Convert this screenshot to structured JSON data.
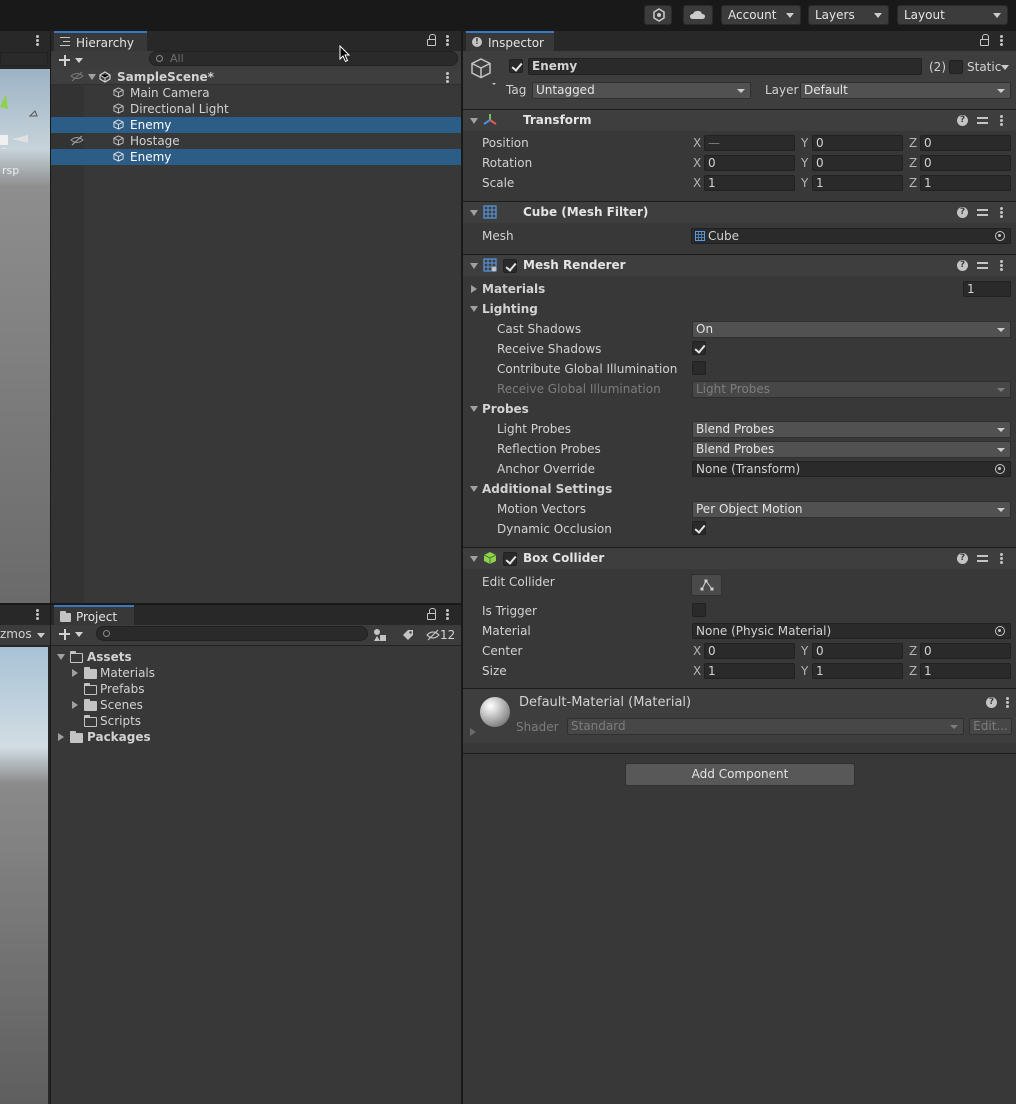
{
  "toolbar": {
    "account_label": "Account",
    "layers_label": "Layers",
    "layout_label": "Layout",
    "collab_icon": "collab-icon",
    "cloud_icon": "cloud-icon"
  },
  "scene_view": {
    "label_fragment": "rsp",
    "gizmos_fragment": "zmos"
  },
  "hierarchy": {
    "tab_label": "Hierarchy",
    "search_placeholder": "All",
    "items": [
      {
        "label": "SampleScene*"
      },
      {
        "label": "Main Camera"
      },
      {
        "label": "Directional Light"
      },
      {
        "label": "Enemy"
      },
      {
        "label": "Hostage"
      },
      {
        "label": "Enemy"
      }
    ]
  },
  "project": {
    "tab_label": "Project",
    "hidden_count": "12",
    "tree": [
      {
        "label": "Assets"
      },
      {
        "label": "Materials"
      },
      {
        "label": "Prefabs"
      },
      {
        "label": "Scenes"
      },
      {
        "label": "Scripts"
      },
      {
        "label": "Packages"
      }
    ]
  },
  "inspector": {
    "tab_label": "Inspector",
    "object_name": "Enemy",
    "multi_count": "(2)",
    "static_label": "Static",
    "tag_label": "Tag",
    "tag_value": "Untagged",
    "layer_label": "Layer",
    "layer_value": "Default",
    "transform": {
      "title": "Transform",
      "position_label": "Position",
      "rotation_label": "Rotation",
      "scale_label": "Scale",
      "position": {
        "x": "—",
        "y": "0",
        "z": "0"
      },
      "rotation": {
        "x": "0",
        "y": "0",
        "z": "0"
      },
      "scale": {
        "x": "1",
        "y": "1",
        "z": "1"
      }
    },
    "axes": {
      "x": "X",
      "y": "Y",
      "z": "Z"
    },
    "mesh_filter": {
      "title": "Cube (Mesh Filter)",
      "mesh_label": "Mesh",
      "mesh_value": "Cube"
    },
    "mesh_renderer": {
      "title": "Mesh Renderer",
      "materials_label": "Materials",
      "materials_count": "1",
      "lighting_label": "Lighting",
      "cast_shadows_label": "Cast Shadows",
      "cast_shadows_value": "On",
      "receive_shadows_label": "Receive Shadows",
      "contribute_gi_label": "Contribute Global Illumination",
      "receive_gi_label": "Receive Global Illumination",
      "receive_gi_value": "Light Probes",
      "probes_label": "Probes",
      "light_probes_label": "Light Probes",
      "light_probes_value": "Blend Probes",
      "reflection_probes_label": "Reflection Probes",
      "reflection_probes_value": "Blend Probes",
      "anchor_override_label": "Anchor Override",
      "anchor_override_value": "None (Transform)",
      "additional_label": "Additional Settings",
      "motion_vectors_label": "Motion Vectors",
      "motion_vectors_value": "Per Object Motion",
      "dynamic_occlusion_label": "Dynamic Occlusion"
    },
    "box_collider": {
      "title": "Box Collider",
      "edit_collider_label": "Edit Collider",
      "is_trigger_label": "Is Trigger",
      "material_label": "Material",
      "material_value": "None (Physic Material)",
      "center_label": "Center",
      "size_label": "Size",
      "center": {
        "x": "0",
        "y": "0",
        "z": "0"
      },
      "size": {
        "x": "1",
        "y": "1",
        "z": "1"
      }
    },
    "material": {
      "title": "Default-Material (Material)",
      "shader_label": "Shader",
      "shader_value": "Standard",
      "edit_label": "Edit..."
    },
    "add_component_label": "Add Component"
  },
  "colors": {
    "selection": "#2c5d87",
    "accent": "#3a79bb",
    "panel": "#383838"
  }
}
